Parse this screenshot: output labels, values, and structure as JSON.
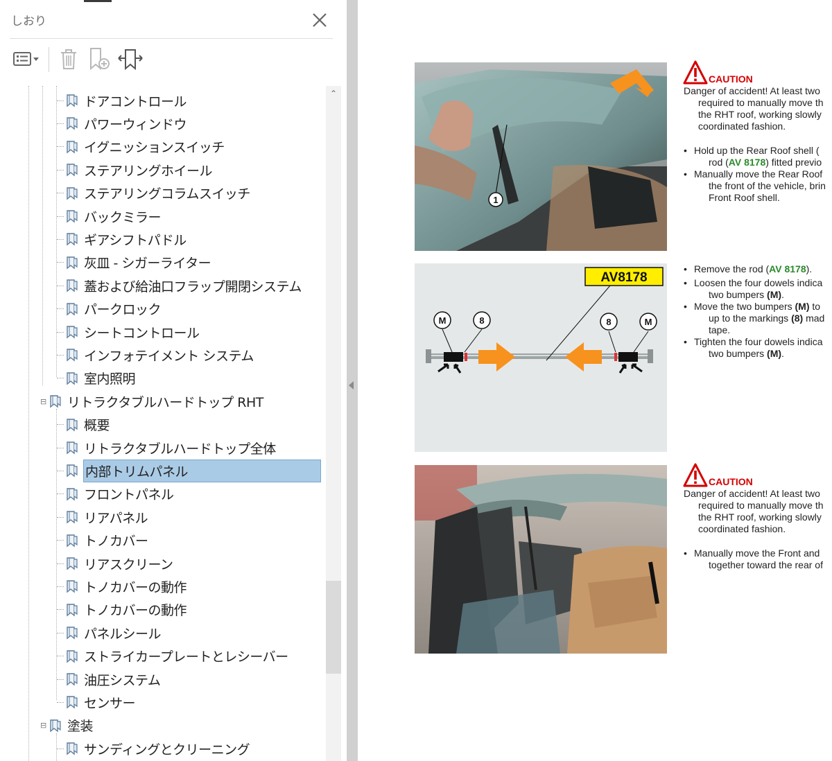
{
  "sidebar": {
    "title": "しおり",
    "items": [
      {
        "label": "ドアコントロール",
        "level": 2
      },
      {
        "label": "パワーウィンドウ",
        "level": 2
      },
      {
        "label": "イグニッションスイッチ",
        "level": 2
      },
      {
        "label": "ステアリングホイール",
        "level": 2
      },
      {
        "label": "ステアリングコラムスイッチ",
        "level": 2
      },
      {
        "label": "バックミラー",
        "level": 2
      },
      {
        "label": "ギアシフトパドル",
        "level": 2
      },
      {
        "label": "灰皿 - シガーライター",
        "level": 2
      },
      {
        "label": "蓋および給油口フラップ開閉システム",
        "level": 2
      },
      {
        "label": "パークロック",
        "level": 2
      },
      {
        "label": "シートコントロール",
        "level": 2
      },
      {
        "label": "インフォテイメント システム",
        "level": 2
      },
      {
        "label": "室内照明",
        "level": 2
      },
      {
        "label": "リトラクタブルハードトップ RHT",
        "level": 1,
        "expanded": true
      },
      {
        "label": "概要",
        "level": 2
      },
      {
        "label": "リトラクタブルハードトップ全体",
        "level": 2
      },
      {
        "label": "内部トリムパネル",
        "level": 2,
        "selected": true
      },
      {
        "label": "フロントパネル",
        "level": 2
      },
      {
        "label": "リアパネル",
        "level": 2
      },
      {
        "label": "トノカバー",
        "level": 2
      },
      {
        "label": "リアスクリーン",
        "level": 2
      },
      {
        "label": "トノカバーの動作",
        "level": 2
      },
      {
        "label": "トノカバーの動作",
        "level": 2
      },
      {
        "label": "パネルシール",
        "level": 2
      },
      {
        "label": "ストライカープレートとレシーバー",
        "level": 2
      },
      {
        "label": "油圧システム",
        "level": 2
      },
      {
        "label": "センサー",
        "level": 2
      },
      {
        "label": "塗装",
        "level": 1,
        "expanded": true
      },
      {
        "label": "サンディングとクリーニング",
        "level": 2
      }
    ]
  },
  "icons": {
    "close": "close-icon",
    "options": "options-menu-icon",
    "delete": "trash-icon",
    "new_bookmark": "new-bookmark-icon",
    "expand": "expand-bookmark-icon",
    "bookmark": "bookmark-icon"
  },
  "colors": {
    "selection": "#aacbe6",
    "caution_red": "#d40000",
    "tool_green": "#2a8a2a",
    "arrow_orange": "#f7921e",
    "callout_yellow": "#ffee00"
  },
  "document": {
    "section1": {
      "caution_word": "CAUTION",
      "caution_lines": [
        "Danger of accident! At least two",
        "required to manually move th",
        "the RHT roof, working slowly",
        "coordinated fashion."
      ],
      "bullet1_a": "Hold up the Rear Roof shell (",
      "bullet1_b_pre": "rod (",
      "bullet1_b_tool": "AV 8178",
      "bullet1_b_post": ") fitted previo",
      "bullet2_lines": [
        "Manually move the Rear Roof",
        "the front of the vehicle, brin",
        "Front Roof shell."
      ],
      "photo_callout": "1"
    },
    "section2": {
      "callout_label": "AV8178",
      "marker_M": "M",
      "marker_8": "8",
      "b1_pre": "Remove the rod (",
      "b1_tool": "AV 8178",
      "b1_post": ").",
      "b2_a": "Loosen the four dowels indica",
      "b2_b_pre": "two bumpers ",
      "b2_b_bold": "(M)",
      "b2_b_post": ".",
      "b3_a_pre": "Move the two bumpers ",
      "b3_a_bold": "(M)",
      "b3_a_post": " to",
      "b3_b_pre": "up to the markings ",
      "b3_b_bold": "(8)",
      "b3_b_post": " mad",
      "b3_c": "tape.",
      "b4_a": "Tighten the four dowels indica",
      "b4_b_pre": "two bumpers ",
      "b4_b_bold": "(M)",
      "b4_b_post": "."
    },
    "section3": {
      "caution_word": "CAUTION",
      "caution_lines": [
        "Danger of accident! At least two",
        "required to manually move th",
        "the RHT roof, working slowly",
        "coordinated fashion."
      ],
      "bullet_lines": [
        "Manually move the Front and",
        "together toward the rear of"
      ]
    }
  }
}
